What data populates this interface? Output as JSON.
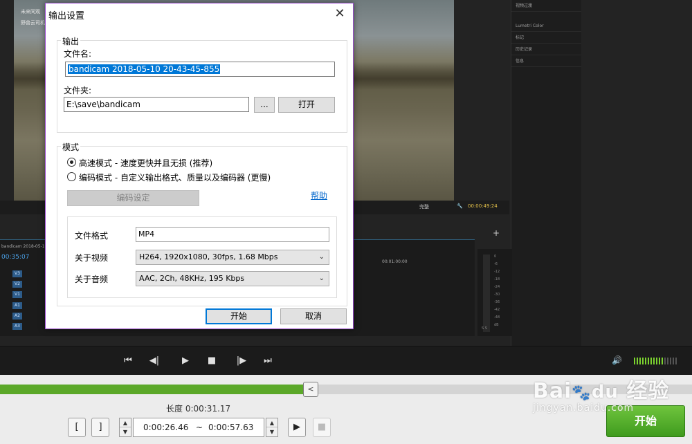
{
  "dialog": {
    "title": "输出设置",
    "close_icon": "close-icon",
    "output_group": "输出",
    "filename_label": "文件名:",
    "filename_value": "bandicam 2018-05-10 20-43-45-855",
    "folder_label": "文件夹:",
    "folder_value": "E:\\save\\bandicam",
    "browse_label": "...",
    "open_label": "打开",
    "mode_group": "模式",
    "mode_fast": "高速模式 - 速度更快并且无损 (推荐)",
    "mode_encode": "编码模式 - 自定义输出格式、质量以及编码器 (更慢)",
    "encode_settings_label": "编码设定",
    "help_link": "帮助",
    "format_label": "文件格式",
    "format_value": "MP4",
    "video_label": "关于视频",
    "video_value": "H264, 1920x1080, 30fps, 1.68 Mbps",
    "audio_label": "关于音频",
    "audio_value": "AAC, 2Ch, 48KHz, 195 Kbps",
    "start_label": "开始",
    "cancel_label": "取消",
    "selected_mode": "fast"
  },
  "editor": {
    "hud_name": "未来同观",
    "hud_tag": "野兽云司机25",
    "clip_name": "bandicam 2018-05-10 19",
    "timecode_left": "00:35:07",
    "timecode_program": "00:00:49:24",
    "zoom_label": "完整",
    "ruler_time": "00:01:00:00",
    "tracks": [
      "V3",
      "V2",
      "V1",
      "A1",
      "A2",
      "A3"
    ],
    "panel_items": [
      "视频过渡",
      "Lumetri Color",
      "标记",
      "历史记录",
      "信息"
    ],
    "meter_ticks": [
      "0",
      "-6",
      "-12",
      "-18",
      "-24",
      "-30",
      "-36",
      "-42",
      "-48",
      "dB"
    ],
    "meter_bottom": "S S"
  },
  "transport": {
    "volume_icon": "volume-icon",
    "volume_level": 0.7
  },
  "bottom": {
    "length_text": "长度 0:00:31.17",
    "start_time": "0:00:26.46",
    "separator": "~",
    "end_time": "0:00:57.63",
    "progress": 0.45,
    "start_button": "开始",
    "progress_handle_glyph": "<"
  },
  "watermark": {
    "brand": "Bai",
    "brand_cn": "经验",
    "url": "jingyan.baidu.com"
  },
  "colors": {
    "accent_green": "#5ba829",
    "dialog_border": "#9b4bd1",
    "link_blue": "#0066cc",
    "selection_blue": "#0078d7"
  }
}
